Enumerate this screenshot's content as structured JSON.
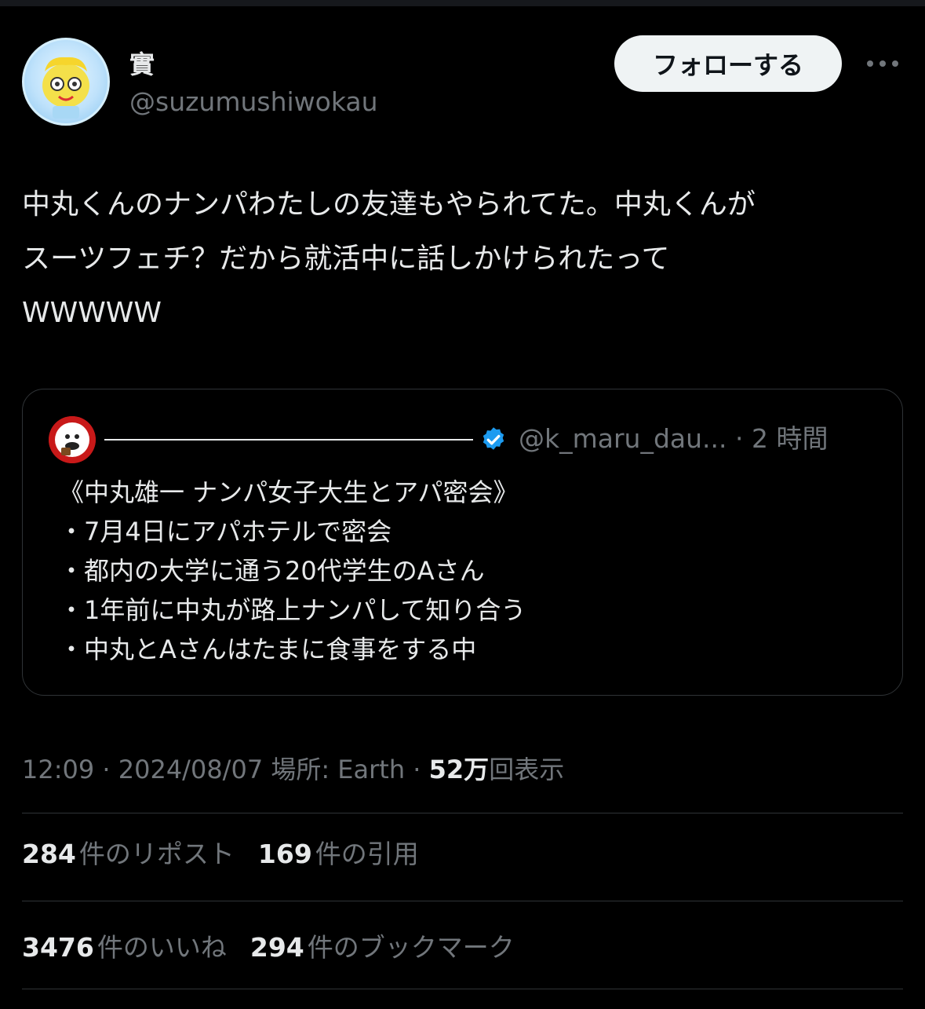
{
  "author": {
    "display_name": "實",
    "handle": "@suzumushiwokau",
    "follow_label": "フォローする"
  },
  "tweet": {
    "lines": [
      "中丸くんのナンパわたしの友達もやられてた。中丸くんが",
      "スーツフェチ？だから就活中に話しかけられたって",
      "WWWWW"
    ]
  },
  "quote": {
    "handle_time": "@k_maru_dau... · 2 時間",
    "lines": [
      "《中丸雄一 ナンパ女子大生とアパ密会》",
      "・7月4日にアパホテルで密会",
      "・都内の大学に通う20代学生のAさん",
      "・1年前に中丸が路上ナンパして知り合う",
      "・中丸とAさんはたまに食事をする中"
    ]
  },
  "meta": {
    "timestamp": "12:09 · 2024/08/07",
    "location": "場所: Earth",
    "separator": "·",
    "views_count": "52万",
    "views_label": "回表示"
  },
  "stats": {
    "reposts_count": "284",
    "reposts_label": "件のリポスト",
    "quotes_count": "169",
    "quotes_label": "件の引用",
    "likes_count": "3476",
    "likes_label": "件のいいね",
    "bookmarks_count": "294",
    "bookmarks_label": "件のブックマーク"
  },
  "colors": {
    "background": "#000000",
    "text": "#e7e9ea",
    "secondary": "#71767b",
    "border": "#2f3336",
    "verified": "#1d9bf0"
  }
}
